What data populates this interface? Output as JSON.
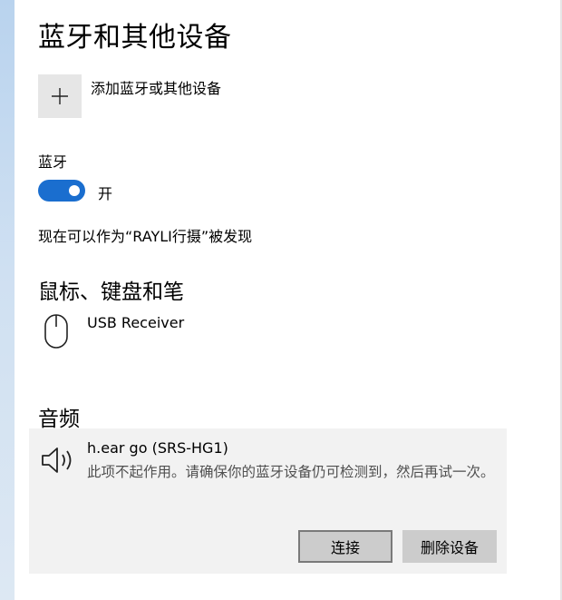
{
  "page": {
    "title": "蓝牙和其他设备"
  },
  "add_device": {
    "icon": "plus-icon",
    "label": "添加蓝牙或其他设备"
  },
  "bluetooth": {
    "label": "蓝牙",
    "toggle_on": true,
    "toggle_state_label": "开",
    "discoverable_text": "现在可以作为“RAYLI行摄”被发现"
  },
  "mouse_keyboard_pen": {
    "heading": "鼠标、键盘和笔",
    "devices": [
      {
        "icon": "mouse-icon",
        "name": "USB Receiver"
      }
    ]
  },
  "audio": {
    "heading": "音频",
    "devices": [
      {
        "icon": "speaker-icon",
        "name": "h.ear go (SRS-HG1)",
        "status": "此项不起作用。请确保你的蓝牙设备仍可检测到，然后再试一次。",
        "buttons": {
          "connect": "连接",
          "remove": "删除设备"
        }
      }
    ]
  },
  "colors": {
    "accent": "#1a6ecf",
    "panel_background": "#f2f2f2",
    "button_background": "#cccccc"
  }
}
